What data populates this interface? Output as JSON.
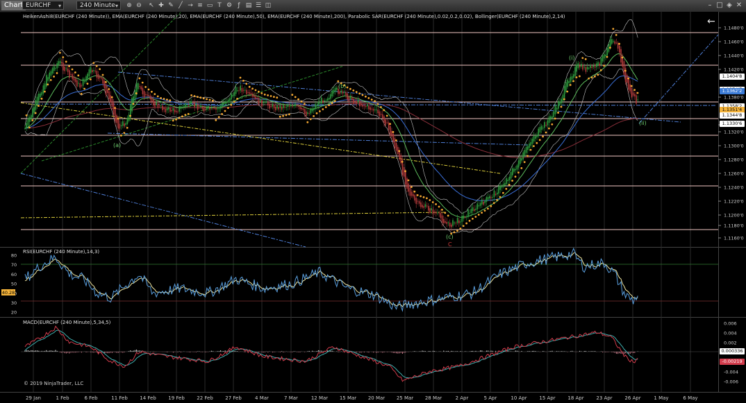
{
  "toolbar": {
    "chart_label": "Chart",
    "instrument": "EURCHF",
    "interval": "240 Minute",
    "back_arrow": "←"
  },
  "labels": {
    "price_indicators": "HeikenAshi8(EURCHF (240 Minute)), EMA(EURCHF (240 Minute),20), EMA(EURCHF (240 Minute),50), EMA(EURCHF (240 Minute),200), Parabolic SAR(EURCHF (240 Minute),0.02,0.2,0.02), Bollinger(EURCHF (240 Minute),2,14)",
    "rsi": "RSI(EURCHF (240 Minute),14,3)",
    "macd": "MACD(EURCHF (240 Minute),5,34,5)",
    "copyright": "© 2019 NinjaTrader, LLC"
  },
  "price_axis": {
    "ticks": [
      "1.1480'0",
      "1.1460'0",
      "1.1440'0",
      "1.1420'0",
      "1.1380'0",
      "1.1340'0",
      "1.1320'0",
      "1.1300'0",
      "1.1280'0",
      "1.1260'0",
      "1.1240'0",
      "1.1220'0",
      "1.1200'0",
      "1.1180'0",
      "1.1160'0"
    ],
    "tags": [
      {
        "text": "1.1404'8",
        "color": "#ffffff"
      },
      {
        "text": "1.1374'7",
        "color": "#ffffff"
      },
      {
        "text": "1.1362'2",
        "color": "#3b7bd6"
      },
      {
        "text": "1.1358'2",
        "color": "#ffffff"
      },
      {
        "text": "1.1351'4",
        "color": "#f4b33a"
      },
      {
        "text": "1.1344'8",
        "color": "#ffffff"
      },
      {
        "text": "1.1330'6",
        "color": "#ffffff"
      }
    ]
  },
  "rsi_axis": {
    "ticks": [
      "80",
      "70",
      "60",
      "50",
      "40",
      "30",
      "20"
    ],
    "current": "40.28"
  },
  "macd_axis": {
    "ticks": [
      "0.006",
      "0.004",
      "0.002",
      "-0.002",
      "-0.004",
      "-0.006"
    ],
    "tags": [
      "0.000336",
      "-0.00219"
    ]
  },
  "time_axis": [
    "29 Jan",
    "1 Feb",
    "6 Feb",
    "11 Feb",
    "14 Feb",
    "19 Feb",
    "22 Feb",
    "27 Feb",
    "4 Mar",
    "7 Mar",
    "12 Mar",
    "15 Mar",
    "20 Mar",
    "25 Mar",
    "28 Mar",
    "2 Apr",
    "5 Apr",
    "10 Apr",
    "15 Apr",
    "18 Apr",
    "23 Apr",
    "26 Apr",
    "1 May",
    "6 May"
  ],
  "wave_labels": [
    "(a)",
    "(b)",
    "(c)",
    "C",
    "(i)",
    "(ii)"
  ],
  "colors": {
    "background": "#000000",
    "grid": "#2a2a2a",
    "horizontal": "#f2c9c4",
    "bull": "#2e9e3e",
    "bear": "#b23a3a",
    "sar": "#f4a832",
    "ema20": "#5dbd5d",
    "ema50": "#3a6fd8",
    "ema200": "#8a2f3a",
    "bollinger": "#c8c8c8",
    "rsi": "#5aa0e0",
    "rsi_signal": "#f0e6a0",
    "macd": "#d23c4c",
    "macd_signal": "#3fb0b0",
    "trend_blue": "#4f7fd8",
    "trend_yellow": "#e0d13c",
    "trend_green": "#2c8a2c"
  }
}
